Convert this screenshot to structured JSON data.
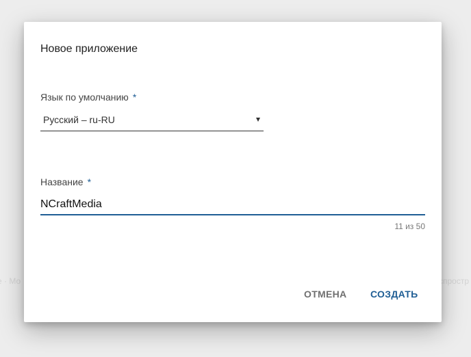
{
  "background": {
    "left_text": "е · Мо",
    "right_text": "спростр"
  },
  "dialog": {
    "title": "Новое приложение",
    "language_field": {
      "label": "Язык по умолчанию",
      "required_mark": "*",
      "selected_value": "Русский – ru-RU"
    },
    "name_field": {
      "label": "Название",
      "required_mark": "*",
      "value": "NCraftMedia",
      "counter": "11 из 50"
    },
    "actions": {
      "cancel_label": "ОТМЕНА",
      "create_label": "СОЗДАТЬ"
    }
  },
  "colors": {
    "accent": "#1e5d94",
    "text_primary": "#212121",
    "text_secondary": "#6f6f6f",
    "backdrop": "#ededed"
  },
  "icons": {
    "dropdown": "chevron-down-icon"
  }
}
